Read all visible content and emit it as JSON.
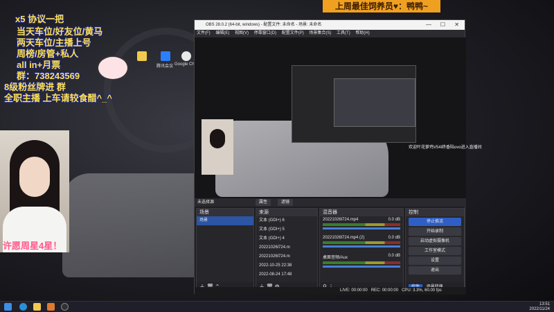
{
  "stream_overlay": {
    "lines": [
      "x5 协议一把",
      "当天车位/好友位/黄马",
      "两天车位/主播上号",
      "周榜/房管+私人",
      "all in+月票",
      "群：738243569",
      "8级粉丝牌进 群",
      "全职主播 上车请较食醋^_^"
    ],
    "banner": "上周最佳饲养员♥：鸭鸭~",
    "caption": "许愿周星4星！",
    "colors": {
      "text_yellow": "#ffe14d",
      "text_white": "#ffffff",
      "banner": "#f0a020"
    }
  },
  "desktop_icons": [
    {
      "icon": "folder-icon",
      "label": ""
    },
    {
      "icon": "app-icon",
      "label": "腾讯会议"
    },
    {
      "icon": "chrome-icon",
      "label": "Google Chrome"
    }
  ],
  "obs": {
    "title": "OBS 28.0.2 (64-bit, windows) - 配置文件: 未命名 - 场景: 未命名",
    "menu": [
      "文件(F)",
      "编辑(E)",
      "视图(V)",
      "停靠窗口(D)",
      "配置文件(P)",
      "场景集合(S)",
      "工具(T)",
      "帮助(H)"
    ],
    "preview_label": "未选择源",
    "buttons": {
      "properties": "属性",
      "filters": "滤镜"
    },
    "scenes": {
      "title": "场景",
      "items": [
        "场景"
      ]
    },
    "sources": {
      "title": "来源",
      "items": [
        "文本 (GDI+) 6",
        "文本 (GDI+) 5",
        "文本 (GDI+) 4",
        "20221026l724.m",
        "20221026l724.m",
        "2022-10-25 22:38",
        "2022-08-24 17:48"
      ]
    },
    "mixer": {
      "title": "混音器",
      "tracks": [
        {
          "name": "20221026l724.mp4",
          "db": "0.0 dB",
          "level": 0.75
        },
        {
          "name": "20221026l724.mp4 (2)",
          "db": "0.0 dB",
          "level": 0.75
        },
        {
          "name": "桌面音频/Aux",
          "db": "0.0 dB",
          "level": 0.7
        }
      ]
    },
    "controls": {
      "title": "控制",
      "items": [
        "停止推流",
        "开始录制",
        "启动虚拟摄像机",
        "工作室模式",
        "设置",
        "退出"
      ],
      "tabs": [
        "控件",
        "场景转换"
      ]
    },
    "status": {
      "live": "LIVE: 00:00:00",
      "rec": "REC: 00:00:00",
      "cpu": "CPU: 3.3%, 60.00 fps"
    }
  },
  "chat_message": "欢迎叶花萝鸡V54l终香陆ovo进入直播间",
  "taskbar": {
    "time": "13:51",
    "date": "2022/11/24"
  }
}
